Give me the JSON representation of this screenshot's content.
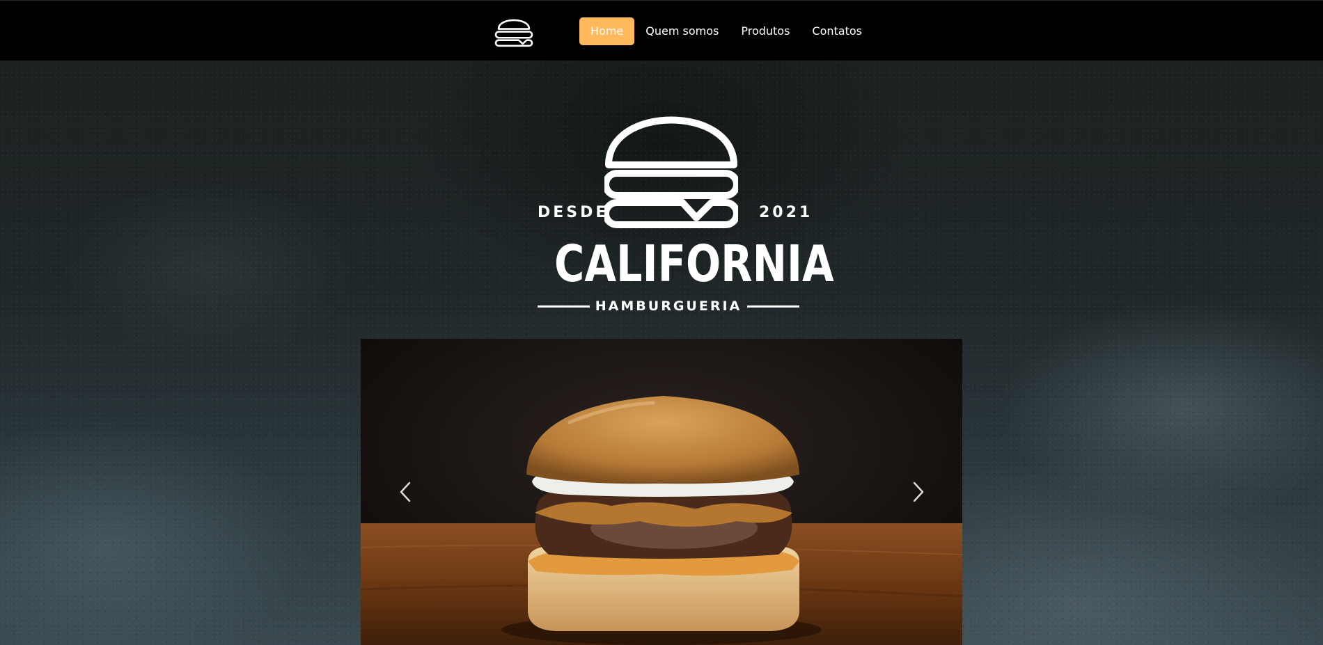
{
  "nav": {
    "logo_icon": "burger-logo-icon",
    "links": [
      {
        "label": "Home",
        "active": true
      },
      {
        "label": "Quem somos",
        "active": false
      },
      {
        "label": "Produtos",
        "active": false
      },
      {
        "label": "Contatos",
        "active": false
      }
    ]
  },
  "hero": {
    "brand": {
      "since": "DESDE",
      "year": "2021",
      "name": "CALIFORNIA",
      "subtitle": "HAMBURGUERIA"
    },
    "carousel": {
      "slide": "burger-photo",
      "prev_icon": "chevron-left-icon",
      "next_icon": "chevron-right-icon"
    }
  },
  "colors": {
    "accent": "#ffb85c",
    "navbar": "#000000"
  }
}
